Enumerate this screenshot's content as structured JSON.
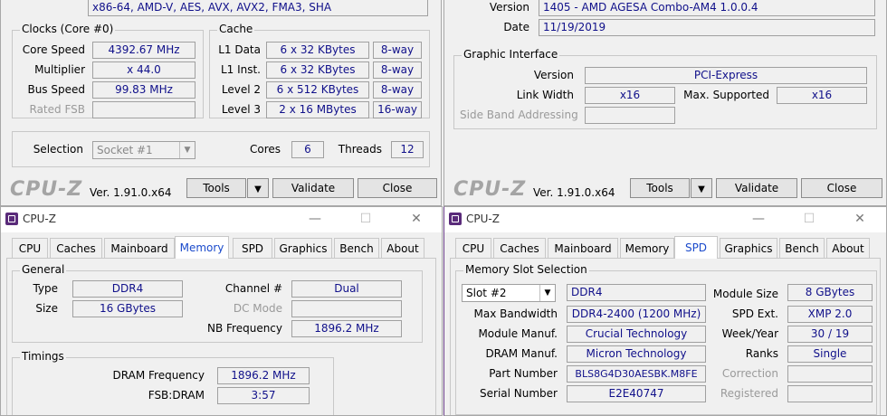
{
  "top_left": {
    "instructions_value": "x86-64, AMD-V, AES, AVX, AVX2, FMA3, SHA",
    "clocks": {
      "title": "Clocks (Core #0)",
      "core_speed_label": "Core Speed",
      "core_speed": "4392.67 MHz",
      "multiplier_label": "Multiplier",
      "multiplier": "x 44.0",
      "bus_speed_label": "Bus Speed",
      "bus_speed": "99.83 MHz",
      "rated_fsb_label": "Rated FSB",
      "rated_fsb": ""
    },
    "cache": {
      "title": "Cache",
      "rows": [
        {
          "label": "L1 Data",
          "size": "6 x 32 KBytes",
          "way": "8-way"
        },
        {
          "label": "L1 Inst.",
          "size": "6 x 32 KBytes",
          "way": "8-way"
        },
        {
          "label": "Level 2",
          "size": "6 x 512 KBytes",
          "way": "8-way"
        },
        {
          "label": "Level 3",
          "size": "2 x 16 MBytes",
          "way": "16-way"
        }
      ]
    },
    "selection_label": "Selection",
    "selection_value": "Socket #1",
    "cores_label": "Cores",
    "cores": "6",
    "threads_label": "Threads",
    "threads": "12",
    "footer": {
      "brand": "CPU-Z",
      "version": "Ver. 1.91.0.x64",
      "tools": "Tools",
      "validate": "Validate",
      "close": "Close"
    }
  },
  "top_right": {
    "version_label": "Version",
    "version": "1405 - AMD AGESA Combo-AM4 1.0.0.4",
    "date_label": "Date",
    "date": "11/19/2019",
    "graphic": {
      "title": "Graphic Interface",
      "version_label": "Version",
      "version": "PCI-Express",
      "link_width_label": "Link Width",
      "link_width": "x16",
      "max_supported_label": "Max. Supported",
      "max_supported": "x16",
      "side_band_label": "Side Band Addressing",
      "side_band": ""
    },
    "footer": {
      "brand": "CPU-Z",
      "version": "Ver. 1.91.0.x64",
      "tools": "Tools",
      "validate": "Validate",
      "close": "Close"
    }
  },
  "memory_window": {
    "title": "CPU-Z",
    "tabs": [
      "CPU",
      "Caches",
      "Mainboard",
      "Memory",
      "SPD",
      "Graphics",
      "Bench",
      "About"
    ],
    "active_tab": "Memory",
    "general": {
      "title": "General",
      "type_label": "Type",
      "type": "DDR4",
      "size_label": "Size",
      "size": "16 GBytes",
      "channel_label": "Channel #",
      "channel": "Dual",
      "dc_mode_label": "DC Mode",
      "dc_mode": "",
      "nb_freq_label": "NB Frequency",
      "nb_freq": "1896.2 MHz"
    },
    "timings": {
      "title": "Timings",
      "dram_freq_label": "DRAM Frequency",
      "dram_freq": "1896.2 MHz",
      "fsb_dram_label": "FSB:DRAM",
      "fsb_dram": "3:57"
    }
  },
  "spd_window": {
    "title": "CPU-Z",
    "tabs": [
      "CPU",
      "Caches",
      "Mainboard",
      "Memory",
      "SPD",
      "Graphics",
      "Bench",
      "About"
    ],
    "active_tab": "SPD",
    "slot": {
      "title": "Memory Slot Selection",
      "slot_value": "Slot #2",
      "type": "DDR4",
      "max_bw_label": "Max Bandwidth",
      "max_bw": "DDR4-2400 (1200 MHz)",
      "module_manuf_label": "Module Manuf.",
      "module_manuf": "Crucial Technology",
      "dram_manuf_label": "DRAM Manuf.",
      "dram_manuf": "Micron Technology",
      "part_number_label": "Part Number",
      "part_number": "BLS8G4D30AESBK.M8FE",
      "serial_label": "Serial Number",
      "serial": "E2E40747",
      "module_size_label": "Module Size",
      "module_size": "8 GBytes",
      "spd_ext_label": "SPD Ext.",
      "spd_ext": "XMP 2.0",
      "week_year_label": "Week/Year",
      "week_year": "30 / 19",
      "ranks_label": "Ranks",
      "ranks": "Single",
      "correction_label": "Correction",
      "correction": "",
      "registered_label": "Registered",
      "registered": ""
    }
  },
  "window_controls": {
    "minimize": "—",
    "maximize": "☐",
    "close": "✕"
  }
}
